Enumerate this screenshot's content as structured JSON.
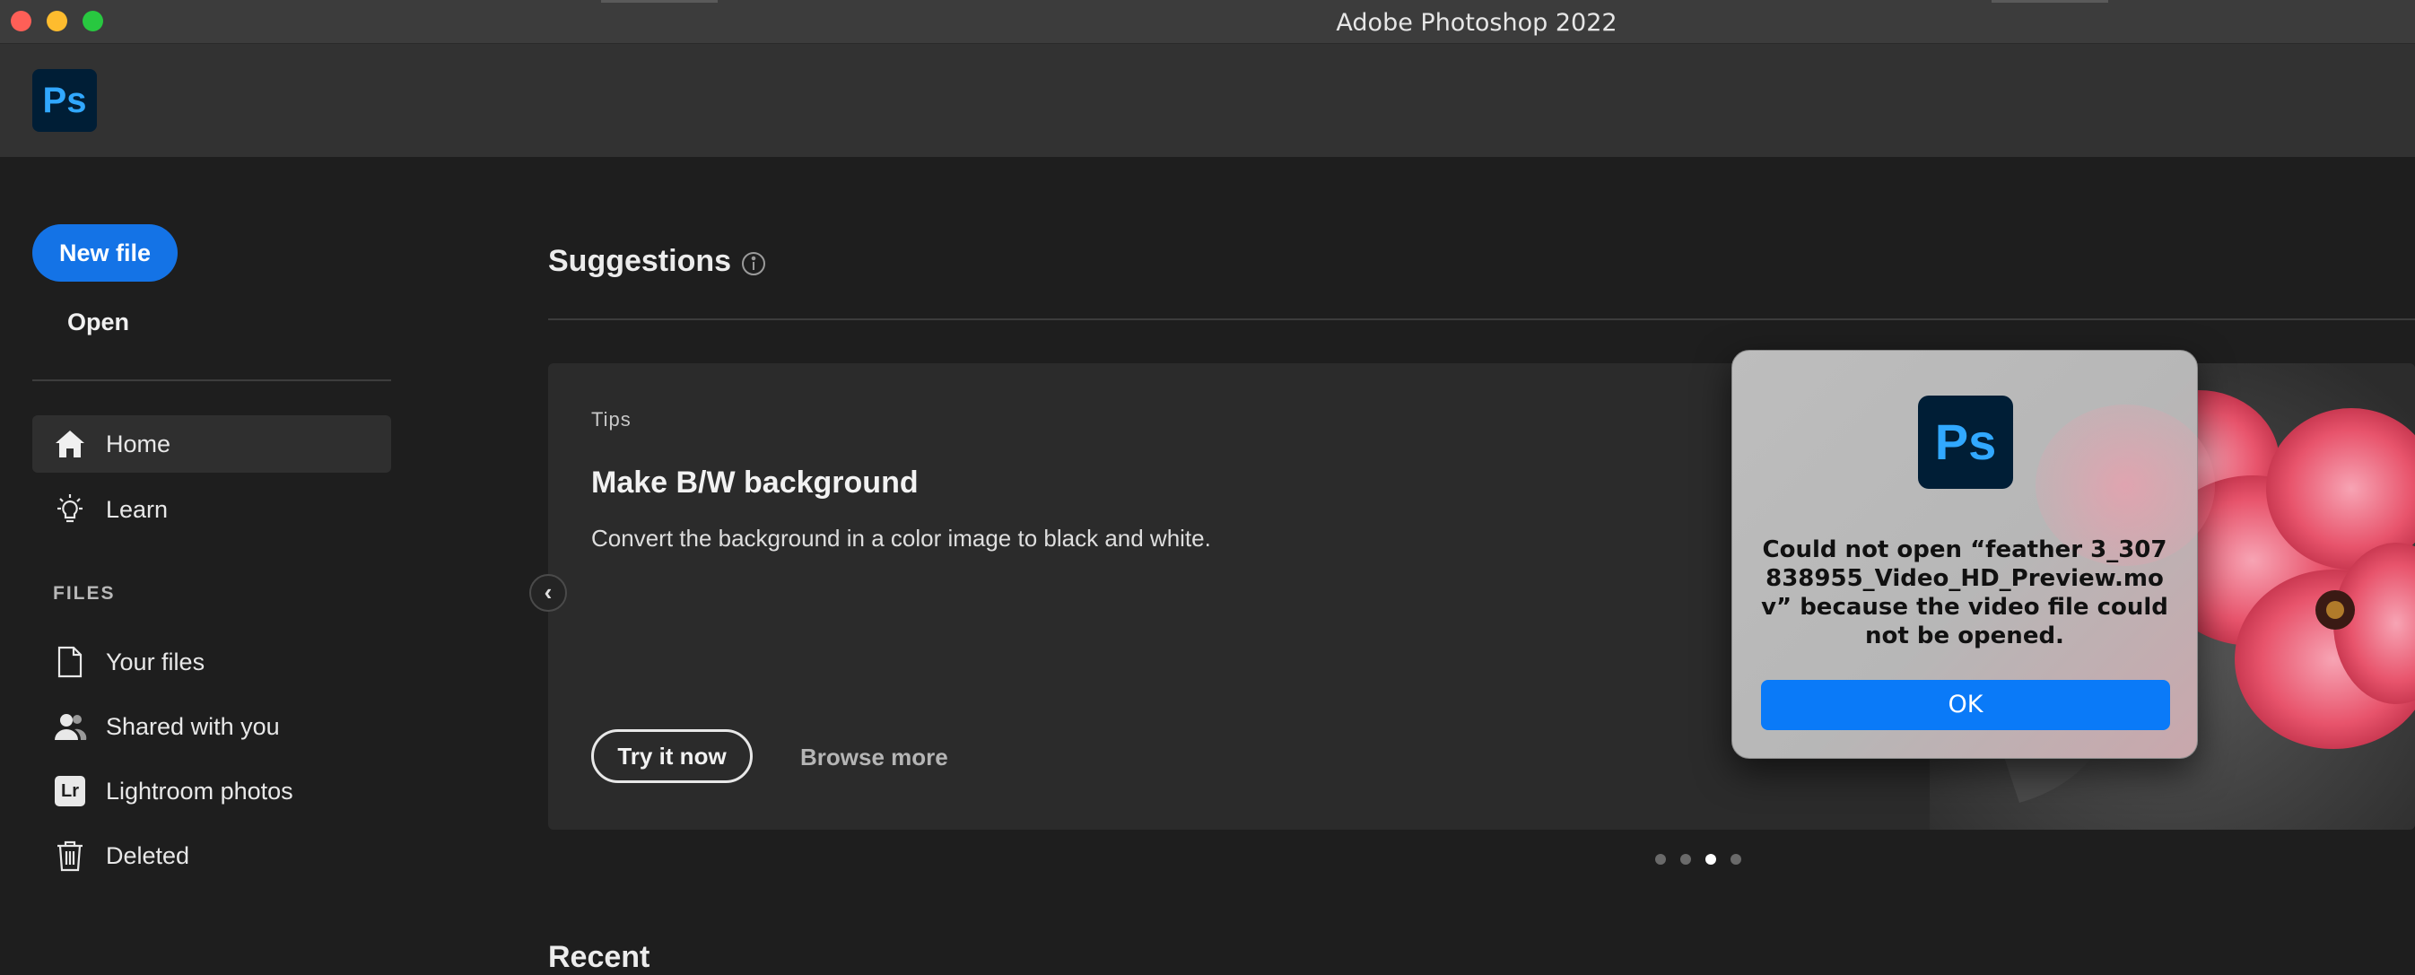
{
  "window": {
    "title": "Adobe Photoshop 2022"
  },
  "app": {
    "logo_text": "Ps"
  },
  "sidebar": {
    "new_file_label": "New file",
    "open_label": "Open",
    "nav": [
      {
        "label": "Home",
        "icon": "home-icon",
        "active": true
      },
      {
        "label": "Learn",
        "icon": "lightbulb-icon"
      }
    ],
    "files_heading": "FILES",
    "files": [
      {
        "label": "Your files",
        "icon": "document-icon"
      },
      {
        "label": "Shared with you",
        "icon": "shared-users-icon"
      },
      {
        "label": "Lightroom photos",
        "icon": "lightroom-icon",
        "icon_text": "Lr"
      },
      {
        "label": "Deleted",
        "icon": "trash-icon"
      }
    ]
  },
  "main": {
    "suggestions_title": "Suggestions",
    "card": {
      "tag": "Tips",
      "title": "Make B/W background",
      "description": "Convert the background in a color image to black and white.",
      "try_label": "Try it now",
      "browse_label": "Browse more"
    },
    "prev_arrow": "‹",
    "carousel": {
      "count": 4,
      "active_index": 2
    },
    "recent_title": "Recent"
  },
  "dialog": {
    "logo_text": "Ps",
    "message": "Could not open “feather 3_307838955_Video_HD_Preview.mov” because the video file could not be opened.",
    "ok_label": "OK"
  },
  "colors": {
    "accent": "#1473e6",
    "ps_blue": "#31a8ff",
    "ps_dark": "#001e36",
    "dialog_ok": "#0a7af8"
  }
}
